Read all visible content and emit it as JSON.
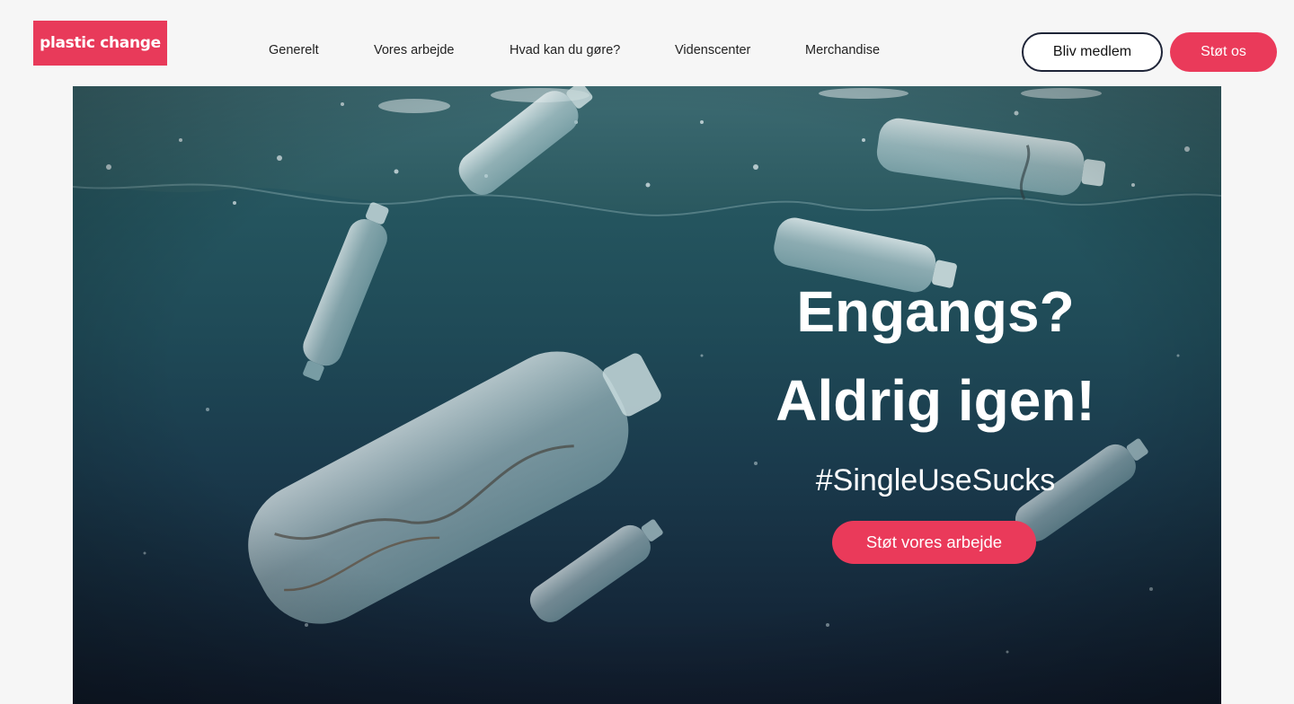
{
  "header": {
    "logo_text": "plastic change",
    "nav": [
      {
        "label": "Generelt"
      },
      {
        "label": "Vores arbejde"
      },
      {
        "label": "Hvad kan du gøre?"
      },
      {
        "label": "Videnscenter"
      },
      {
        "label": "Merchandise"
      }
    ],
    "member_button": "Bliv medlem",
    "support_button": "Støt os"
  },
  "hero": {
    "title_line1": "Engangs?",
    "title_line2": "Aldrig igen!",
    "hashtag": "#SingleUseSucks",
    "cta_label": "Støt vores arbejde",
    "image_subject": "plastic bottles floating under the ocean surface"
  },
  "colors": {
    "brand": "#e83a5a",
    "accent": "#ea3a5a",
    "nav_text": "#222222",
    "page_background": "#f6f6f6",
    "button_border": "#1e2437"
  }
}
